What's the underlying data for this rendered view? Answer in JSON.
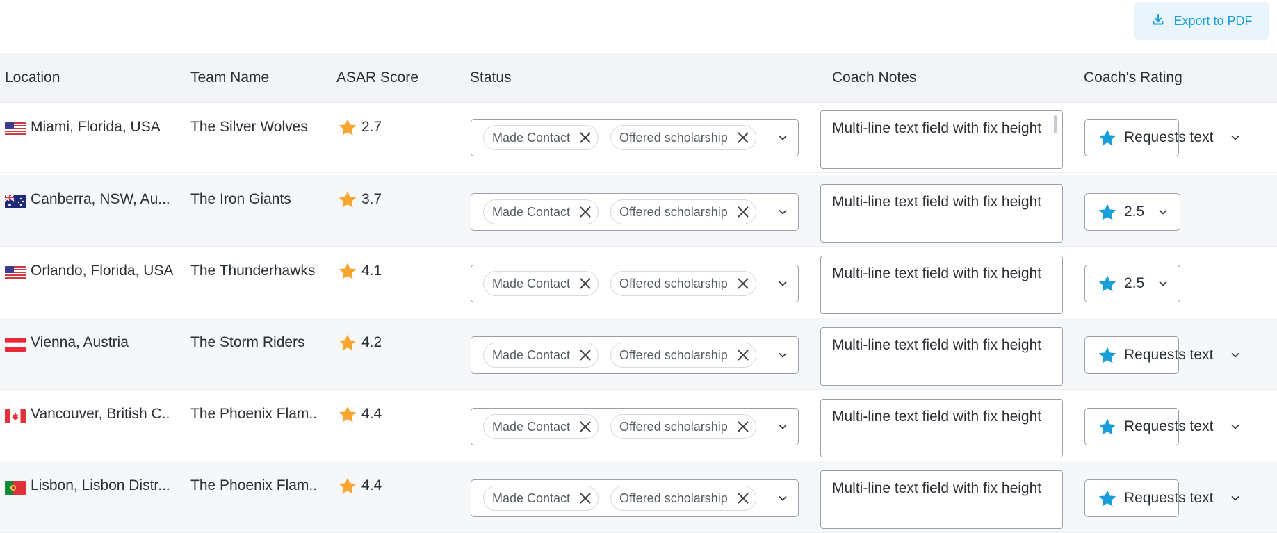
{
  "toolbar": {
    "export_label": "Export to PDF"
  },
  "columns": {
    "location": "Location",
    "team_name": "Team Name",
    "asar_score": "ASAR Score",
    "status": "Status",
    "coach_notes": "Coach Notes",
    "coach_rating": "Coach's Rating"
  },
  "colors": {
    "accent": "#1a9ed9",
    "score_star": "#f8a531",
    "rating_star": "#1a9ed9"
  },
  "rows": [
    {
      "flag": "usa",
      "location": "Miami, Florida, USA",
      "team": "The Silver Wolves",
      "score": "2.7",
      "status_chips": [
        "Made Contact",
        "Offered scholarship"
      ],
      "notes": "Multi-line text field with fix height",
      "rating": "Requests text"
    },
    {
      "flag": "australia",
      "location": "Canberra, NSW, Au...",
      "team": "The Iron Giants",
      "score": "3.7",
      "status_chips": [
        "Made Contact",
        "Offered scholarship"
      ],
      "notes": "Multi-line text field with fix height",
      "rating": "2.5"
    },
    {
      "flag": "usa",
      "location": "Orlando, Florida, USA",
      "team": "The Thunderhawks",
      "score": "4.1",
      "status_chips": [
        "Made Contact",
        "Offered scholarship"
      ],
      "notes": "Multi-line text field with fix height",
      "rating": "2.5"
    },
    {
      "flag": "austria",
      "location": "Vienna, Austria",
      "team": "The Storm Riders",
      "score": "4.2",
      "status_chips": [
        "Made Contact",
        "Offered scholarship"
      ],
      "notes": "Multi-line text field with fix height",
      "rating": "Requests text"
    },
    {
      "flag": "canada",
      "location": "Vancouver, British C..",
      "team": "The Phoenix Flam..",
      "score": "4.4",
      "status_chips": [
        "Made Contact",
        "Offered scholarship"
      ],
      "notes": "Multi-line text field with fix height",
      "rating": "Requests text"
    },
    {
      "flag": "portugal",
      "location": "Lisbon, Lisbon Distr...",
      "team": "The Phoenix Flam..",
      "score": "4.4",
      "status_chips": [
        "Made Contact",
        "Offered scholarship"
      ],
      "notes": "Multi-line text field with fix height",
      "rating": "Requests text"
    }
  ]
}
